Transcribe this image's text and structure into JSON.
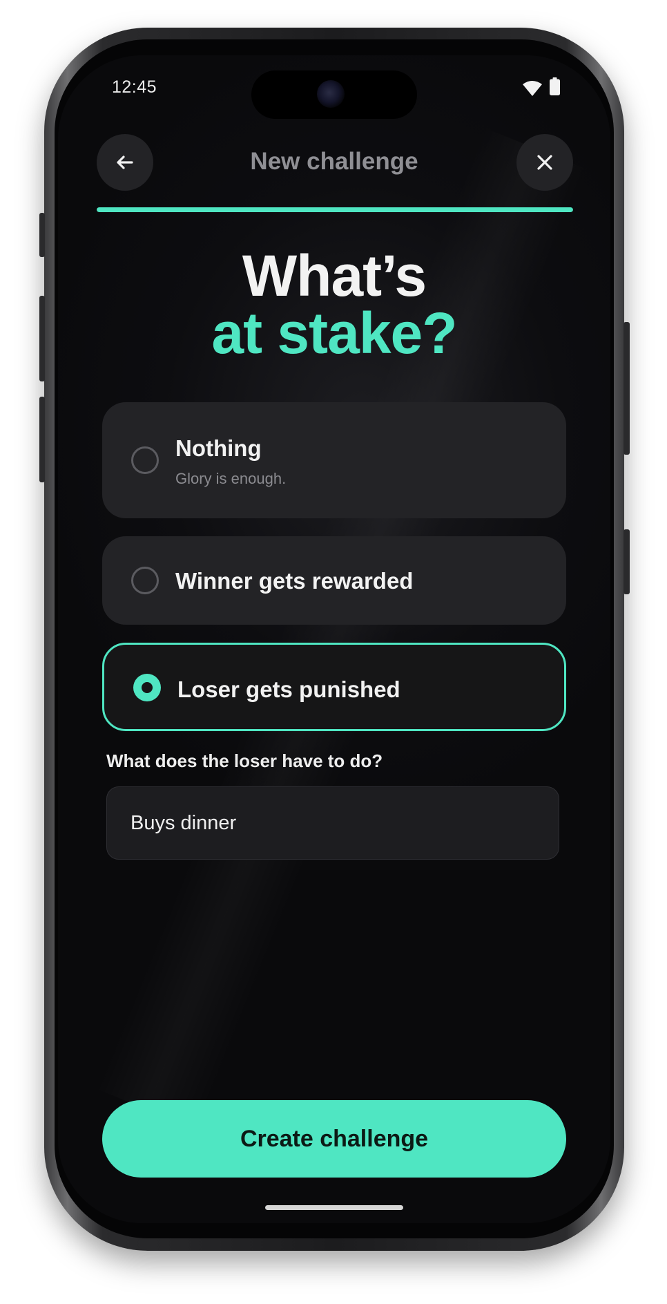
{
  "theme": {
    "accent": "#4fe6c2",
    "background": "#0b0b0d",
    "card": "#232326"
  },
  "status_bar": {
    "time": "12:45",
    "icons": [
      "wifi-icon",
      "battery-icon"
    ]
  },
  "header": {
    "title": "New challenge",
    "back_icon": "arrow-left-icon",
    "close_icon": "close-icon",
    "progress": 1.0
  },
  "heading": {
    "line1": "What’s",
    "line2": "at stake?"
  },
  "options": [
    {
      "title": "Nothing",
      "subtitle": "Glory is enough.",
      "selected": false
    },
    {
      "title": "Winner gets rewarded",
      "selected": false
    },
    {
      "title": "Loser gets punished",
      "selected": true
    }
  ],
  "punishment": {
    "label": "What does the loser have to do?",
    "value": "Buys dinner"
  },
  "cta": {
    "label": "Create challenge"
  }
}
